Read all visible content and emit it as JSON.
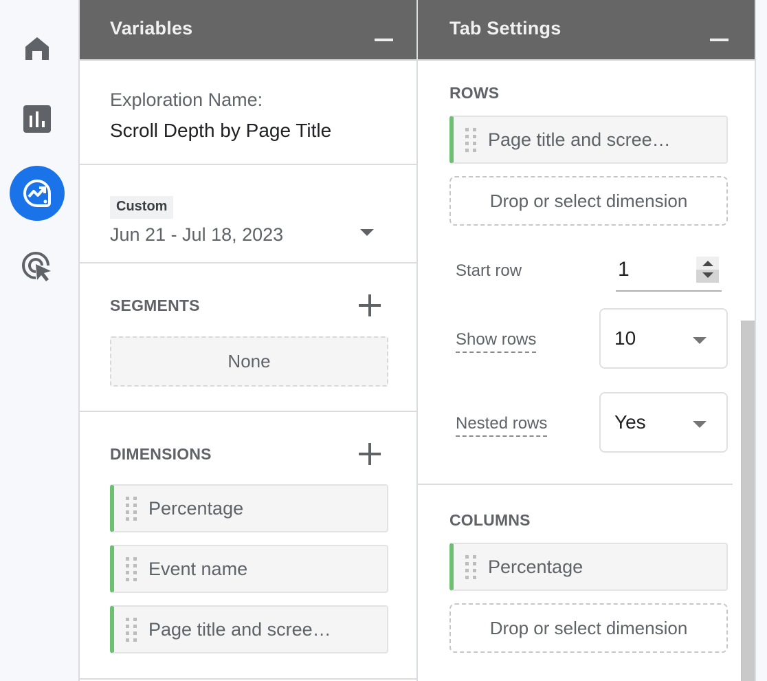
{
  "nav_rail": {
    "items": [
      {
        "name": "home",
        "icon": "home-icon",
        "active": false
      },
      {
        "name": "reports",
        "icon": "bar-chart-icon",
        "active": false
      },
      {
        "name": "explore",
        "icon": "explore-trend-icon",
        "active": true
      },
      {
        "name": "advertising",
        "icon": "target-cursor-icon",
        "active": false
      }
    ],
    "active_color": "#1a73e8"
  },
  "variables_panel": {
    "title": "Variables",
    "exploration_label": "Exploration Name:",
    "exploration_name": "Scroll Depth by Page Title",
    "date_range": {
      "badge": "Custom",
      "value": "Jun 21 - Jul 18, 2023"
    },
    "segments": {
      "heading": "SEGMENTS",
      "empty_label": "None"
    },
    "dimensions": {
      "heading": "DIMENSIONS",
      "items": [
        {
          "label": "Percentage"
        },
        {
          "label": "Event name"
        },
        {
          "label": "Page title and scree…"
        }
      ]
    }
  },
  "tab_settings_panel": {
    "title": "Tab Settings",
    "rows": {
      "heading": "ROWS",
      "items": [
        {
          "label": "Page title and scree…"
        }
      ],
      "drop_placeholder": "Drop or select dimension",
      "start_row": {
        "label": "Start row",
        "value": "1"
      },
      "show_rows": {
        "label": "Show rows",
        "value": "10"
      },
      "nested_rows": {
        "label": "Nested rows",
        "value": "Yes"
      }
    },
    "columns": {
      "heading": "COLUMNS",
      "items": [
        {
          "label": "Percentage"
        }
      ],
      "drop_placeholder": "Drop or select dimension"
    }
  },
  "colors": {
    "header_bg": "#666666",
    "chip_accent": "#6fbf73",
    "accent_blue": "#1a73e8"
  }
}
